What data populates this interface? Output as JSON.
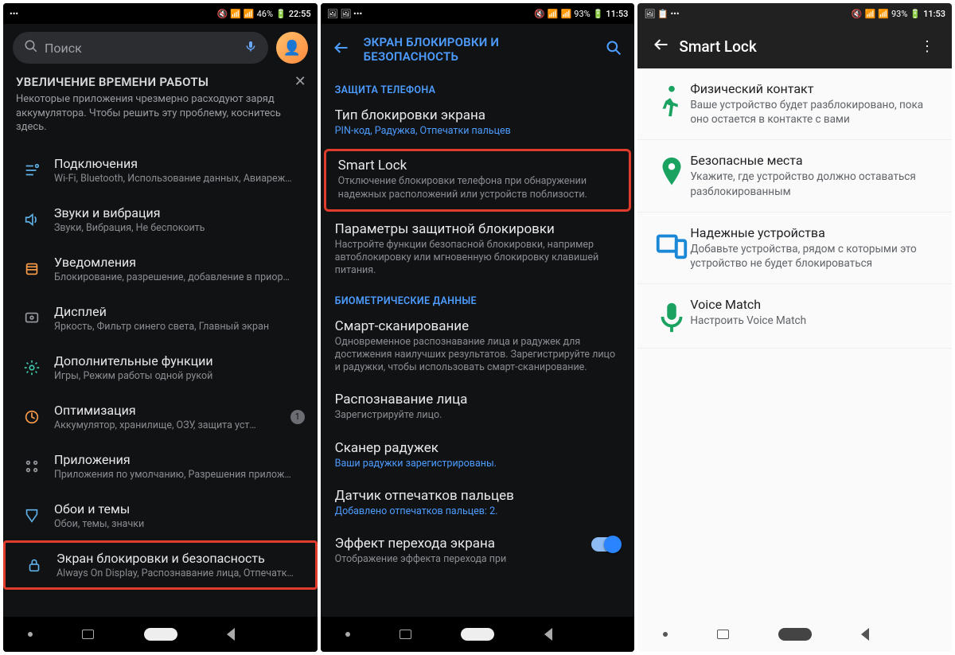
{
  "screen1": {
    "status": {
      "left": "•••",
      "mute": "🔇",
      "wifi": "📶",
      "signal": "📶",
      "battery": "46%",
      "bat_icon": "🔋",
      "time": "22:55"
    },
    "search_placeholder": "Поиск",
    "notice_title": "УВЕЛИЧЕНИЕ ВРЕМЕНИ РАБОТЫ",
    "notice_body": "Некоторые приложения чрезмерно расходуют заряд аккумулятора. Чтобы решить эту проблему, коснитесь здесь.",
    "items": [
      {
        "title": "Подключения",
        "sub": "Wi-Fi, Bluetooth, Использование данных, Авиареж…",
        "icon": "connections"
      },
      {
        "title": "Звуки и вибрация",
        "sub": "Звуки, Вибрация, Не беспокоить",
        "icon": "sound"
      },
      {
        "title": "Уведомления",
        "sub": "Блокирование, разрешение, добавление в приор…",
        "icon": "notifications"
      },
      {
        "title": "Дисплей",
        "sub": "Яркость, Фильтр синего света, Главный экран",
        "icon": "display"
      },
      {
        "title": "Дополнительные функции",
        "sub": "Игры, Режим работы одной рукой",
        "icon": "advanced"
      },
      {
        "title": "Оптимизация",
        "sub": "Аккумулятор, хранилище, ОЗУ, защита уст…",
        "icon": "battery",
        "badge": "1"
      },
      {
        "title": "Приложения",
        "sub": "Приложения по умолчанию, Разрешения прилож…",
        "icon": "apps"
      },
      {
        "title": "Обои и темы",
        "sub": "Обои, темы, значки",
        "icon": "themes"
      },
      {
        "title": "Экран блокировки и безопасность",
        "sub": "Always On Display, Распознавание лица, Отпечатк…",
        "icon": "lock",
        "highlight": true
      }
    ]
  },
  "screen2": {
    "status": {
      "left": "🖼 🖼 •••",
      "mute": "🔇",
      "wifi": "📶",
      "signal": "📶",
      "battery": "93%",
      "bat_icon": "🔋",
      "time": "11:53"
    },
    "title": "ЭКРАН БЛОКИРОВКИ И БЕЗОПАСНОСТЬ",
    "section1": "ЗАЩИТА ТЕЛЕФОНА",
    "lock_type_t": "Тип блокировки экрана",
    "lock_type_d": "PIN-код, Радужка, Отпечатки пальцев",
    "smart_t": "Smart Lock",
    "smart_d": "Отключение блокировки телефона при обнаружении надежных расположений или устройств поблизости.",
    "secure_t": "Параметры защитной блокировки",
    "secure_d": "Настройте функции безопасной блокировки, например автоблокировку или мгновенную блокировку клавишей питания.",
    "section2": "БИОМЕТРИЧЕСКИЕ ДАННЫЕ",
    "scan_t": "Смарт-сканирование",
    "scan_d": "Одновременное распознавание лица и радужек для достижения наилучших результатов. Зарегистрируйте лицо и радужки, чтобы использовать смарт-сканирование.",
    "face_t": "Распознавание лица",
    "face_d": "Зарегистрируйте лицо.",
    "iris_t": "Сканер радужек",
    "iris_d": "Ваши радужки зарегистрированы.",
    "finger_t": "Датчик отпечатков пальцев",
    "finger_d": "Добавлено отпечатков пальцев: 2.",
    "trans_t": "Эффект перехода экрана",
    "trans_d": "Отображение эффекта перехода при"
  },
  "screen3": {
    "status": {
      "left": "🖼 📋 •••",
      "mute": "🔇",
      "wifi": "📶",
      "signal": "📶",
      "battery": "93%",
      "bat_icon": "🔋",
      "time": "11:53"
    },
    "title": "Smart Lock",
    "items": [
      {
        "t": "Физический контакт",
        "d": "Ваше устройство будет разблокировано, пока оно остается в контакте с вами",
        "icon": "walk",
        "color": "#1aa260"
      },
      {
        "t": "Безопасные места",
        "d": "Укажите, где устройство должно оставаться разблокированным",
        "icon": "pin",
        "color": "#1aa260"
      },
      {
        "t": "Надежные устройства",
        "d": "Добавьте устройства, рядом с которыми это устройство не будет блокироваться",
        "icon": "devices",
        "color": "#1a88d6"
      },
      {
        "t": "Voice Match",
        "d": "Настроить Voice Match",
        "icon": "mic",
        "color": "#1aa260"
      }
    ]
  }
}
